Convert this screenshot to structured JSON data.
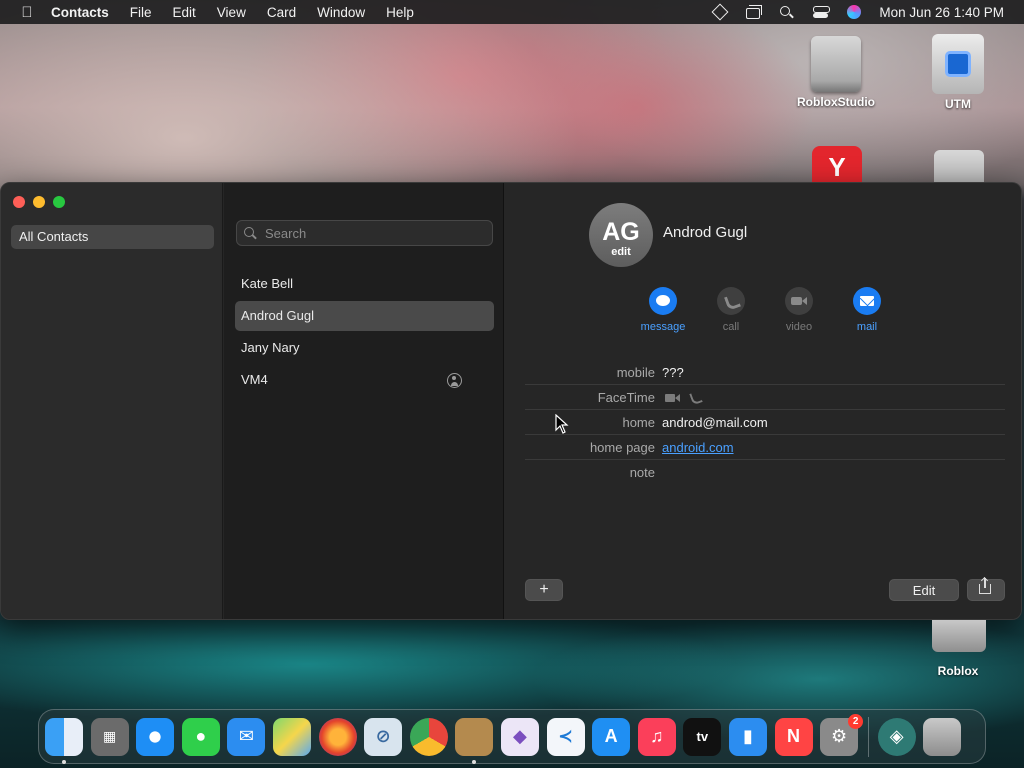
{
  "menubar": {
    "app_name": "Contacts",
    "menus": [
      "File",
      "Edit",
      "View",
      "Card",
      "Window",
      "Help"
    ],
    "clock": "Mon Jun 26  1:40 PM"
  },
  "desktop": {
    "icons": [
      {
        "label": "RobloxStudio"
      },
      {
        "label": "UTM"
      },
      {
        "label": "Roblox"
      }
    ]
  },
  "sidebar": {
    "groups": [
      "All Contacts"
    ]
  },
  "list": {
    "search_placeholder": "Search",
    "contacts": [
      "Kate Bell",
      "Androd Gugl",
      "Jany Nary",
      "VM4"
    ],
    "selected": "Androd Gugl"
  },
  "detail": {
    "initials": "AG",
    "avatar_edit_label": "edit",
    "name": "Androd Gugl",
    "actions": [
      {
        "label": "message",
        "active": true
      },
      {
        "label": "call",
        "active": false
      },
      {
        "label": "video",
        "active": false
      },
      {
        "label": "mail",
        "active": true
      }
    ],
    "fields": [
      {
        "label": "mobile",
        "value": "???"
      },
      {
        "label": "FaceTime",
        "value": ""
      },
      {
        "label": "home",
        "value": "androd@mail.com"
      },
      {
        "label": "home page",
        "value": "android.com"
      },
      {
        "label": "note",
        "value": ""
      }
    ],
    "add_button": "+",
    "edit_button": "Edit"
  },
  "dock": {
    "apps": [
      "finder-icon",
      "launchpad-icon",
      "safari-icon",
      "messages-icon",
      "mail-icon",
      "maps-icon",
      "firefox-icon",
      "compress-icon",
      "chrome-icon",
      "contacts-icon",
      "visual-studio-icon",
      "vscode-icon",
      "app-store-icon",
      "music-icon",
      "apple-tv-icon",
      "keynote-icon",
      "news-icon",
      "system-settings-icon",
      "app-icon",
      "trash-icon"
    ],
    "settings_badge": "2"
  },
  "colors": {
    "accent": "#1a7cf2",
    "link": "#4aa0ff",
    "selection": "#4a4a4a"
  }
}
